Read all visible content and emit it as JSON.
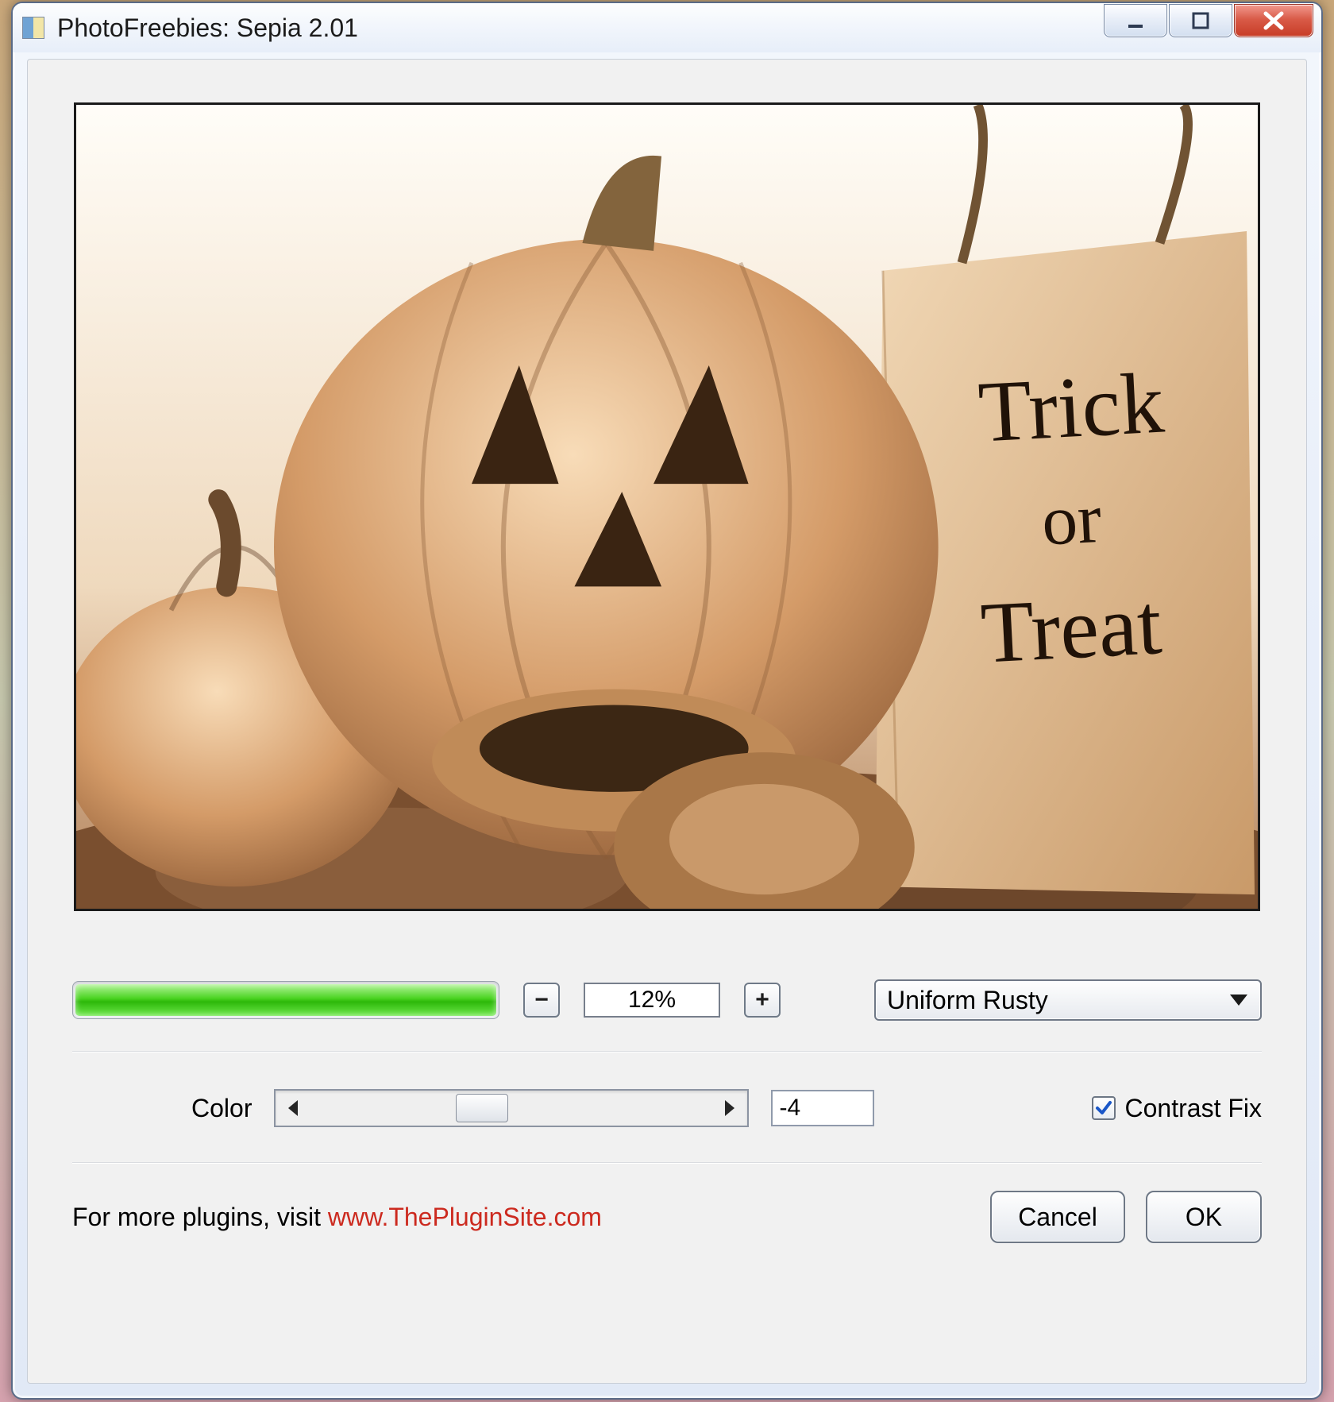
{
  "window": {
    "title": "PhotoFreebies: Sepia 2.01"
  },
  "controls": {
    "progress_pct": "12%",
    "minus": "−",
    "plus": "+",
    "preset": "Uniform Rusty",
    "color_label": "Color",
    "color_value": "-4",
    "contrast_fix_label": "Contrast Fix",
    "contrast_fix_checked": true
  },
  "preview": {
    "sign_line1": "Trick",
    "sign_line2": "or",
    "sign_line3": "Treat"
  },
  "footer": {
    "prefix": "For more plugins, visit ",
    "link": "www.ThePluginSite.com",
    "cancel": "Cancel",
    "ok": "OK"
  }
}
